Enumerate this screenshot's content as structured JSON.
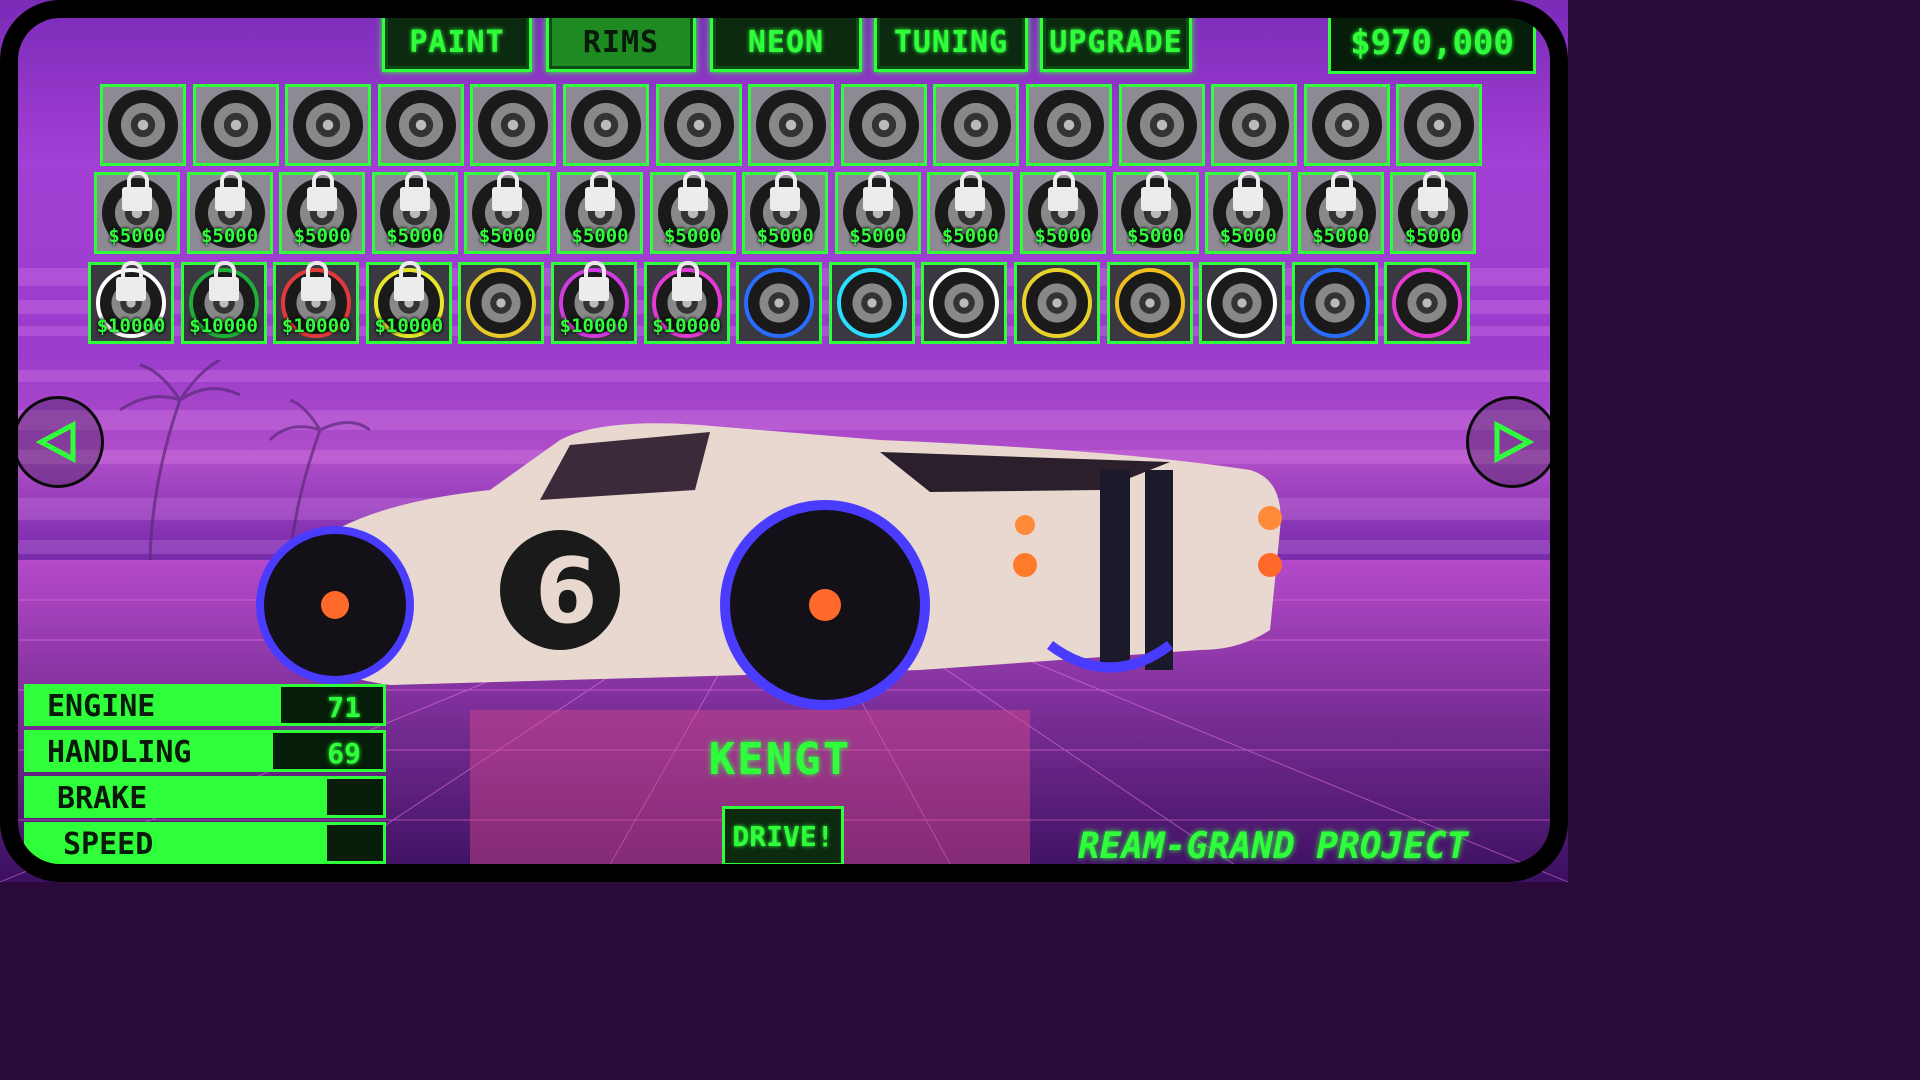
{
  "tabs": [
    {
      "label": "PAINT",
      "active": false
    },
    {
      "label": "RIMS",
      "active": true
    },
    {
      "label": "NEON",
      "active": false
    },
    {
      "label": "TUNING",
      "active": false
    },
    {
      "label": "UPGRADE",
      "active": false
    }
  ],
  "money": "$970,000",
  "rims": {
    "row1": [
      {
        "locked": false
      },
      {
        "locked": false
      },
      {
        "locked": false
      },
      {
        "locked": false
      },
      {
        "locked": false
      },
      {
        "locked": false
      },
      {
        "locked": false
      },
      {
        "locked": false
      },
      {
        "locked": false
      },
      {
        "locked": false
      },
      {
        "locked": false
      },
      {
        "locked": false
      },
      {
        "locked": false
      },
      {
        "locked": false
      },
      {
        "locked": false
      }
    ],
    "row2": [
      {
        "locked": true,
        "price": "$5000"
      },
      {
        "locked": true,
        "price": "$5000"
      },
      {
        "locked": true,
        "price": "$5000"
      },
      {
        "locked": true,
        "price": "$5000"
      },
      {
        "locked": true,
        "price": "$5000"
      },
      {
        "locked": true,
        "price": "$5000"
      },
      {
        "locked": true,
        "price": "$5000"
      },
      {
        "locked": true,
        "price": "$5000"
      },
      {
        "locked": true,
        "price": "$5000"
      },
      {
        "locked": true,
        "price": "$5000"
      },
      {
        "locked": true,
        "price": "$5000"
      },
      {
        "locked": true,
        "price": "$5000"
      },
      {
        "locked": true,
        "price": "$5000"
      },
      {
        "locked": true,
        "price": "$5000"
      },
      {
        "locked": true,
        "price": "$5000"
      }
    ],
    "row3": [
      {
        "locked": true,
        "price": "$10000",
        "ring": "#ffffff"
      },
      {
        "locked": true,
        "price": "$10000",
        "ring": "#1fae3a"
      },
      {
        "locked": true,
        "price": "$10000",
        "ring": "#e23a3a"
      },
      {
        "locked": true,
        "price": "$10000",
        "ring": "#e6e62a"
      },
      {
        "locked": false,
        "ring": "#e6c82a"
      },
      {
        "locked": true,
        "price": "$10000",
        "ring": "#d23ae2"
      },
      {
        "locked": true,
        "price": "$10000",
        "ring": "#e23ad2"
      },
      {
        "locked": false,
        "ring": "#2a6cff"
      },
      {
        "locked": false,
        "ring": "#2adfff"
      },
      {
        "locked": false,
        "ring": "#ffffff"
      },
      {
        "locked": false,
        "ring": "#e6d22a"
      },
      {
        "locked": false,
        "ring": "#f0c020"
      },
      {
        "locked": false,
        "ring": "#ffffff"
      },
      {
        "locked": false,
        "ring": "#2a6cff"
      },
      {
        "locked": false,
        "ring": "#e23ad2"
      }
    ]
  },
  "stats": [
    {
      "label": "ENGINE",
      "value": "71"
    },
    {
      "label": "HANDLING",
      "value": "69"
    },
    {
      "label": "BRAKE",
      "value": "87"
    },
    {
      "label": "SPEED",
      "value": "87"
    }
  ],
  "car_name": "KENGT",
  "drive_label": "DRIVE!",
  "game_logo": "REAM-GRAND PROJECT",
  "colors": {
    "accent": "#2fff3a",
    "neon_wheel": "#4a3cff",
    "car_body": "#e8d8d0"
  }
}
